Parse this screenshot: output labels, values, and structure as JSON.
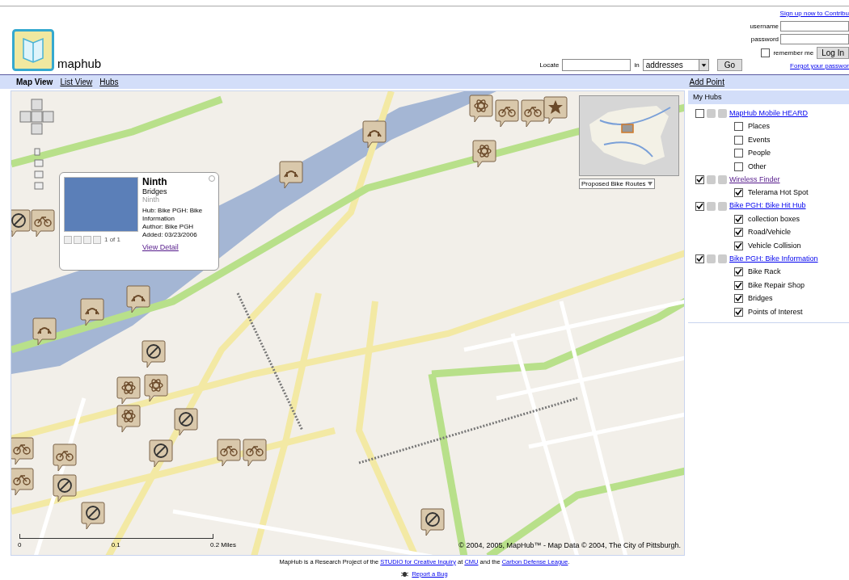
{
  "header": {
    "logo_text": "maphub",
    "signup_link": "Sign up now to Contribu",
    "username_label": "username",
    "password_label": "password",
    "remember": {
      "label": "remember me",
      "checked": false
    },
    "login_button": "Log In",
    "forgot_link": "Forgot your passwor",
    "locate_label": "Locate",
    "in_label": "in",
    "locate_select": "addresses",
    "go_button": "Go"
  },
  "nav": {
    "tabs": [
      {
        "label": "Map View",
        "selected": true
      },
      {
        "label": "List View",
        "selected": false
      },
      {
        "label": "Hubs",
        "selected": false
      }
    ],
    "add_point": "Add Point"
  },
  "map": {
    "popup": {
      "title": "Ninth",
      "category": "Bridges",
      "subtitle": "Ninth",
      "details": [
        "Hub: Bike PGH: Bike Information",
        "Author: Bike PGH",
        "Added: 03/23/2006"
      ],
      "link": "View Detail",
      "pager": "1 of 1"
    },
    "overview_select": "Proposed Bike Routes",
    "scale_labels": [
      "0",
      "0.1",
      "0.2 Miles"
    ],
    "copyright": "© 2004, 2005, MapHub™ - Map Data © 2004, The City of Pittsburgh."
  },
  "sidebar": {
    "title": "My Hubs",
    "hubs": [
      {
        "label": "MapHub Mobile HEARD",
        "checked": false,
        "visited": false,
        "children": [
          {
            "label": "Places",
            "checked": false
          },
          {
            "label": "Events",
            "checked": false
          },
          {
            "label": "People",
            "checked": false
          },
          {
            "label": "Other",
            "checked": false
          }
        ]
      },
      {
        "label": "Wireless Finder",
        "checked": true,
        "visited": true,
        "children": [
          {
            "label": "Telerama Hot Spot",
            "checked": true
          }
        ]
      },
      {
        "label": "Bike PGH: Bike Hit Hub",
        "checked": true,
        "visited": false,
        "children": [
          {
            "label": "collection boxes",
            "checked": true
          },
          {
            "label": "Road/Vehicle",
            "checked": true
          },
          {
            "label": "Vehicle Collision",
            "checked": true
          }
        ]
      },
      {
        "label": "Bike PGH: Bike Information",
        "checked": true,
        "visited": false,
        "children": [
          {
            "label": "Bike Rack",
            "checked": true
          },
          {
            "label": "Bike Repair Shop",
            "checked": true
          },
          {
            "label": "Bridges",
            "checked": true
          },
          {
            "label": "Points of Interest",
            "checked": true
          }
        ]
      }
    ]
  },
  "footer": {
    "credit_parts": [
      {
        "kind": "text",
        "text": "MapHub is a Research Project of the "
      },
      {
        "kind": "link",
        "text": "STUDIO for Creative Inquiry"
      },
      {
        "kind": "text",
        "text": " at "
      },
      {
        "kind": "link",
        "text": "CMU"
      },
      {
        "kind": "text",
        "text": " and the "
      },
      {
        "kind": "link",
        "text": "Carbon Defense League"
      },
      {
        "kind": "text",
        "text": "."
      }
    ],
    "bug_link": "Report a Bug"
  }
}
